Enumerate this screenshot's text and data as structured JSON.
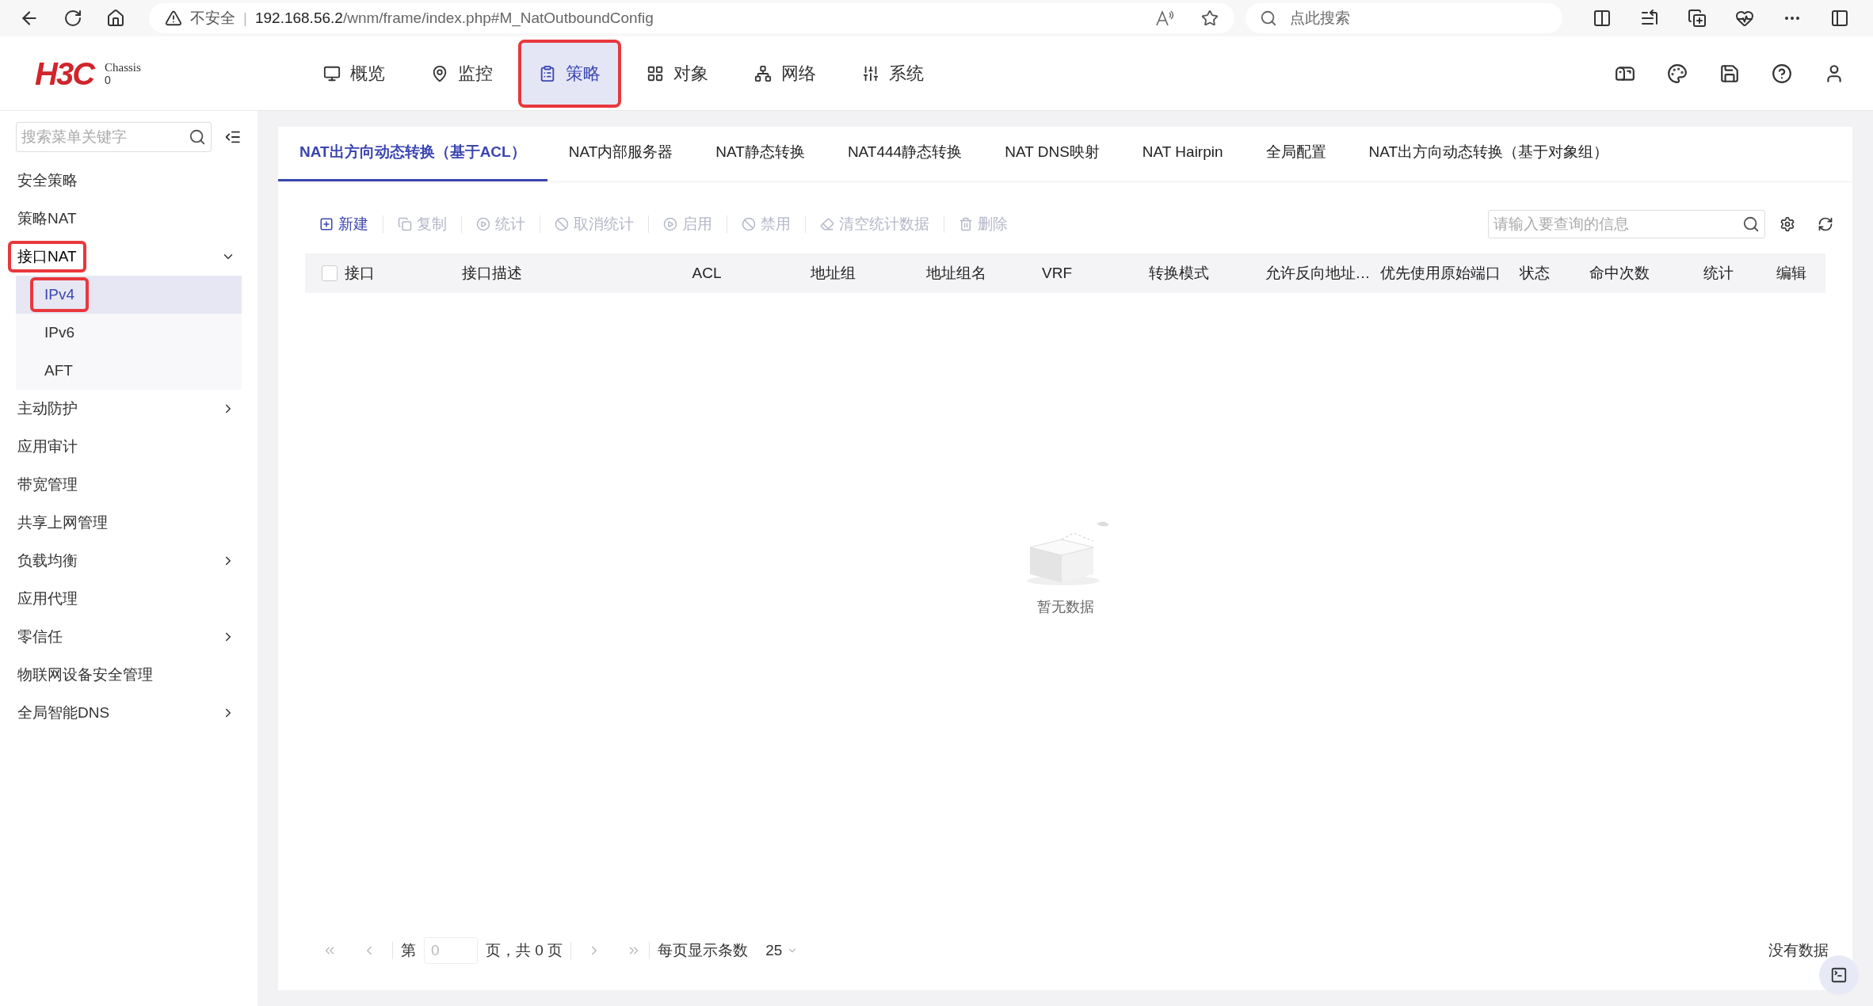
{
  "browser": {
    "security": "不安全",
    "separator": "|",
    "url_host": "192.168.56.2",
    "url_path": "/wnm/frame/index.php#M_NatOutboundConfig",
    "search_placeholder": "点此搜索"
  },
  "header": {
    "logo": "H3C",
    "chassis_label": "Chassis",
    "chassis_value": "0",
    "nav": [
      {
        "label": "概览",
        "selected": false,
        "annotated": false
      },
      {
        "label": "监控",
        "selected": false,
        "annotated": false
      },
      {
        "label": "策略",
        "selected": true,
        "annotated": true
      },
      {
        "label": "对象",
        "selected": false,
        "annotated": false
      },
      {
        "label": "网络",
        "selected": false,
        "annotated": false
      },
      {
        "label": "系统",
        "selected": false,
        "annotated": false
      }
    ]
  },
  "sidebar": {
    "search_placeholder": "搜索菜单关键字",
    "items": [
      {
        "label": "安全策略",
        "kind": "leaf",
        "annotated": false
      },
      {
        "label": "策略NAT",
        "kind": "leaf",
        "annotated": false
      },
      {
        "label": "接口NAT",
        "kind": "group",
        "expanded": true,
        "annotated": true,
        "children": [
          {
            "label": "IPv4",
            "selected": true,
            "annotated": true
          },
          {
            "label": "IPv6",
            "selected": false,
            "annotated": false
          },
          {
            "label": "AFT",
            "selected": false,
            "annotated": false
          }
        ]
      },
      {
        "label": "主动防护",
        "kind": "group",
        "expanded": false,
        "annotated": false
      },
      {
        "label": "应用审计",
        "kind": "leaf",
        "annotated": false
      },
      {
        "label": "带宽管理",
        "kind": "leaf",
        "annotated": false
      },
      {
        "label": "共享上网管理",
        "kind": "leaf",
        "annotated": false
      },
      {
        "label": "负载均衡",
        "kind": "group",
        "expanded": false,
        "annotated": false
      },
      {
        "label": "应用代理",
        "kind": "leaf",
        "annotated": false
      },
      {
        "label": "零信任",
        "kind": "group",
        "expanded": false,
        "annotated": false
      },
      {
        "label": "物联网设备安全管理",
        "kind": "leaf",
        "annotated": false
      },
      {
        "label": "全局智能DNS",
        "kind": "group",
        "expanded": false,
        "annotated": false
      }
    ]
  },
  "tabs": [
    {
      "label": "NAT出方向动态转换（基于ACL）",
      "selected": true
    },
    {
      "label": "NAT内部服务器",
      "selected": false
    },
    {
      "label": "NAT静态转换",
      "selected": false
    },
    {
      "label": "NAT444静态转换",
      "selected": false
    },
    {
      "label": "NAT DNS映射",
      "selected": false
    },
    {
      "label": "NAT Hairpin",
      "selected": false
    },
    {
      "label": "全局配置",
      "selected": false
    },
    {
      "label": "NAT出方向动态转换（基于对象组）",
      "selected": false
    }
  ],
  "toolbar": [
    {
      "label": "新建",
      "disabled": false
    },
    {
      "label": "复制",
      "disabled": true
    },
    {
      "label": "统计",
      "disabled": true
    },
    {
      "label": "取消统计",
      "disabled": true
    },
    {
      "label": "启用",
      "disabled": true
    },
    {
      "label": "禁用",
      "disabled": true
    },
    {
      "label": "清空统计数据",
      "disabled": true
    },
    {
      "label": "删除",
      "disabled": true
    }
  ],
  "query_placeholder": "请输入要查询的信息",
  "table": {
    "select_all_checked": false,
    "columns": [
      "接口",
      "接口描述",
      "ACL",
      "地址组",
      "地址组名",
      "VRF",
      "转换模式",
      "允许反向地址…",
      "优先使用原始端口",
      "状态",
      "命中次数",
      "统计",
      "编辑"
    ],
    "empty_text": "暂无数据"
  },
  "pagination": {
    "page_prefix": "第",
    "page_value": "0",
    "page_suffix": "页，共 0 页",
    "page_size_label": "每页显示条数",
    "page_size": "25",
    "status": "没有数据"
  }
}
